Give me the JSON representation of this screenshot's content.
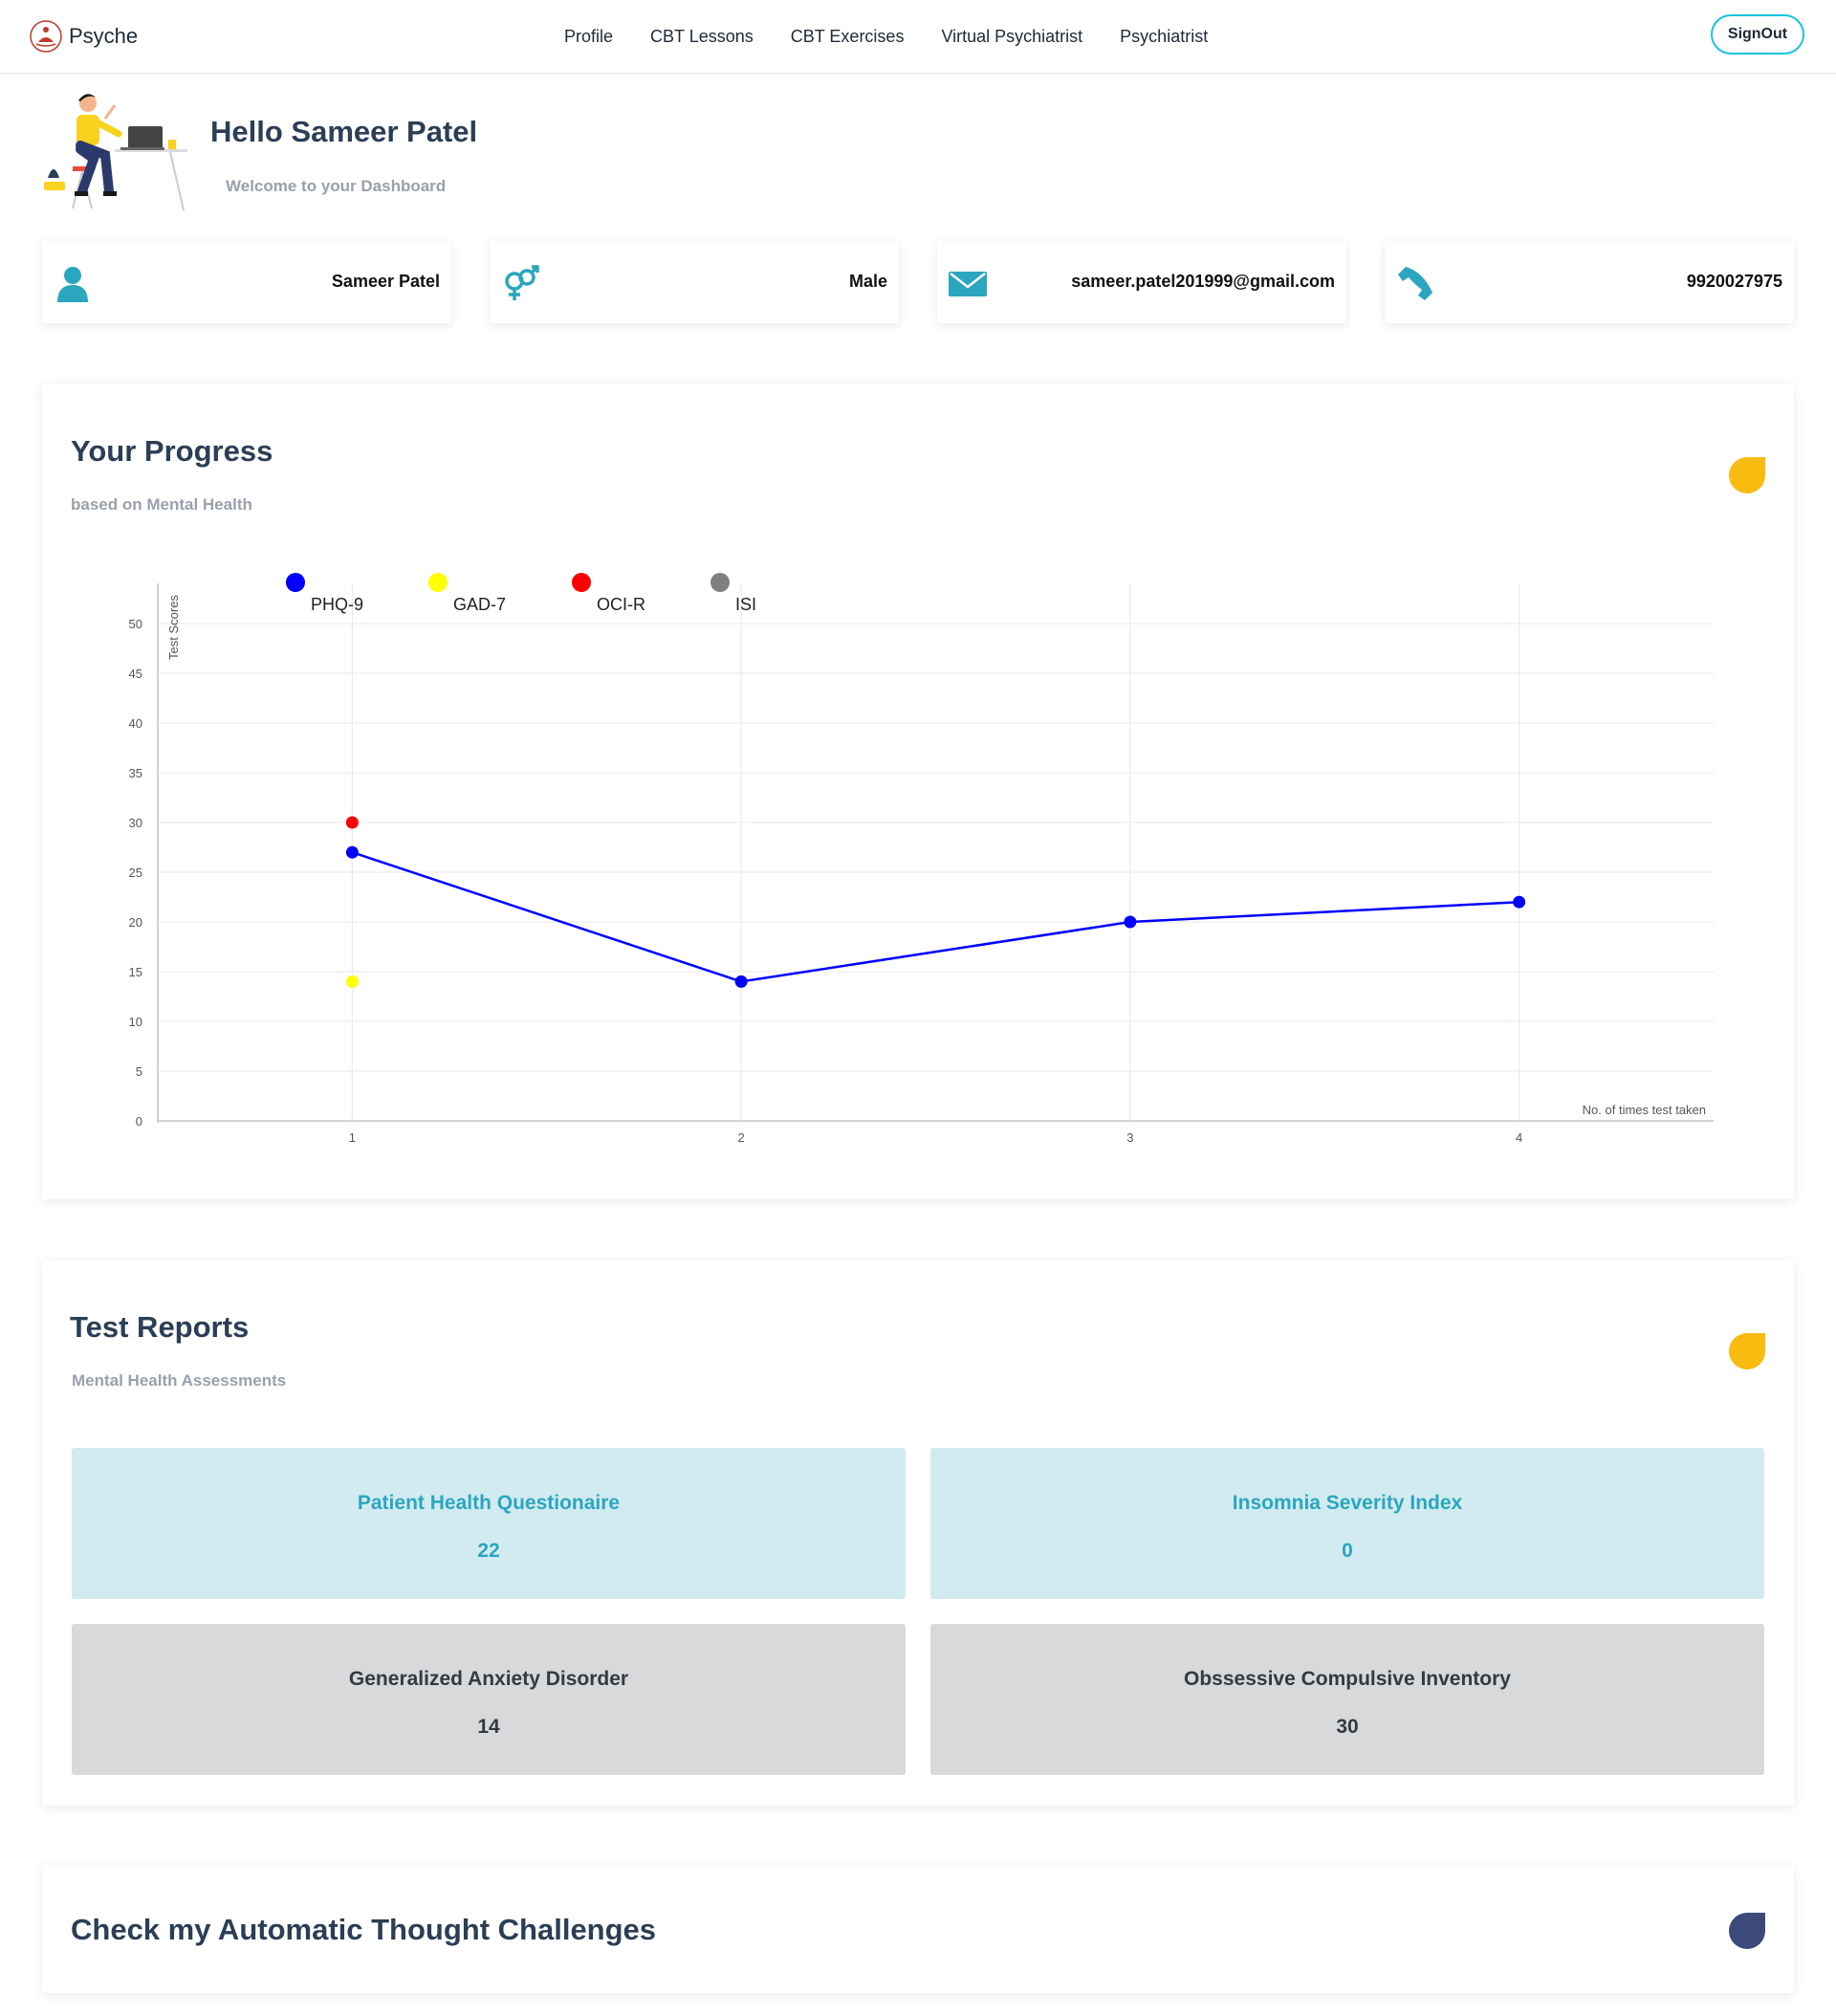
{
  "nav": {
    "brand": "Psyche",
    "links": [
      "Profile",
      "CBT Lessons",
      "CBT Exercises",
      "Virtual Psychiatrist",
      "Psychiatrist"
    ],
    "signout": "SignOut"
  },
  "hero": {
    "greeting": "Hello Sameer Patel",
    "welcome": "Welcome to your Dashboard"
  },
  "info": {
    "name": "Sameer Patel",
    "gender": "Male",
    "email": "sameer.patel201999@gmail.com",
    "phone": "9920027975"
  },
  "colors": {
    "accent": "#2ba6bf",
    "title": "#2b3e55",
    "badge_yellow": "#f8bb10",
    "badge_navy": "#3b4a7a",
    "signout_border": "#17c3de"
  },
  "progress": {
    "title": "Your Progress",
    "subtitle": "based on Mental Health"
  },
  "chart_data": {
    "type": "line",
    "title": "",
    "xlabel": "No. of times test taken",
    "ylabel": "Test Scores",
    "x": [
      1,
      2,
      3,
      4
    ],
    "xlim": [
      0.5,
      4.5
    ],
    "ylim": [
      0,
      50
    ],
    "yticks": [
      0,
      5,
      10,
      15,
      20,
      25,
      30,
      35,
      40,
      45,
      50
    ],
    "grid": true,
    "legend_position": "top",
    "series": [
      {
        "name": "PHQ-9",
        "color": "#0000ff",
        "values": [
          27,
          14,
          20,
          22
        ]
      },
      {
        "name": "GAD-7",
        "color": "#ffff00",
        "values": [
          14
        ]
      },
      {
        "name": "OCI-R",
        "color": "#ff0000",
        "values": [
          30
        ]
      },
      {
        "name": "ISI",
        "color": "#808080",
        "values": []
      }
    ]
  },
  "reports": {
    "title": "Test Reports",
    "subtitle": "Mental Health Assessments",
    "tiles": [
      {
        "name": "Patient Health Questionaire",
        "value": "22"
      },
      {
        "name": "Insomnia Severity Index",
        "value": "0"
      },
      {
        "name": "Generalized Anxiety Disorder",
        "value": "14"
      },
      {
        "name": "Obssessive Compulsive Inventory",
        "value": "30"
      }
    ]
  },
  "thoughts": {
    "title": "Check my Automatic Thought Challenges"
  },
  "icons": {
    "user": "user-icon",
    "gender": "gender-icon",
    "email": "envelope-icon",
    "phone": "phone-icon"
  }
}
